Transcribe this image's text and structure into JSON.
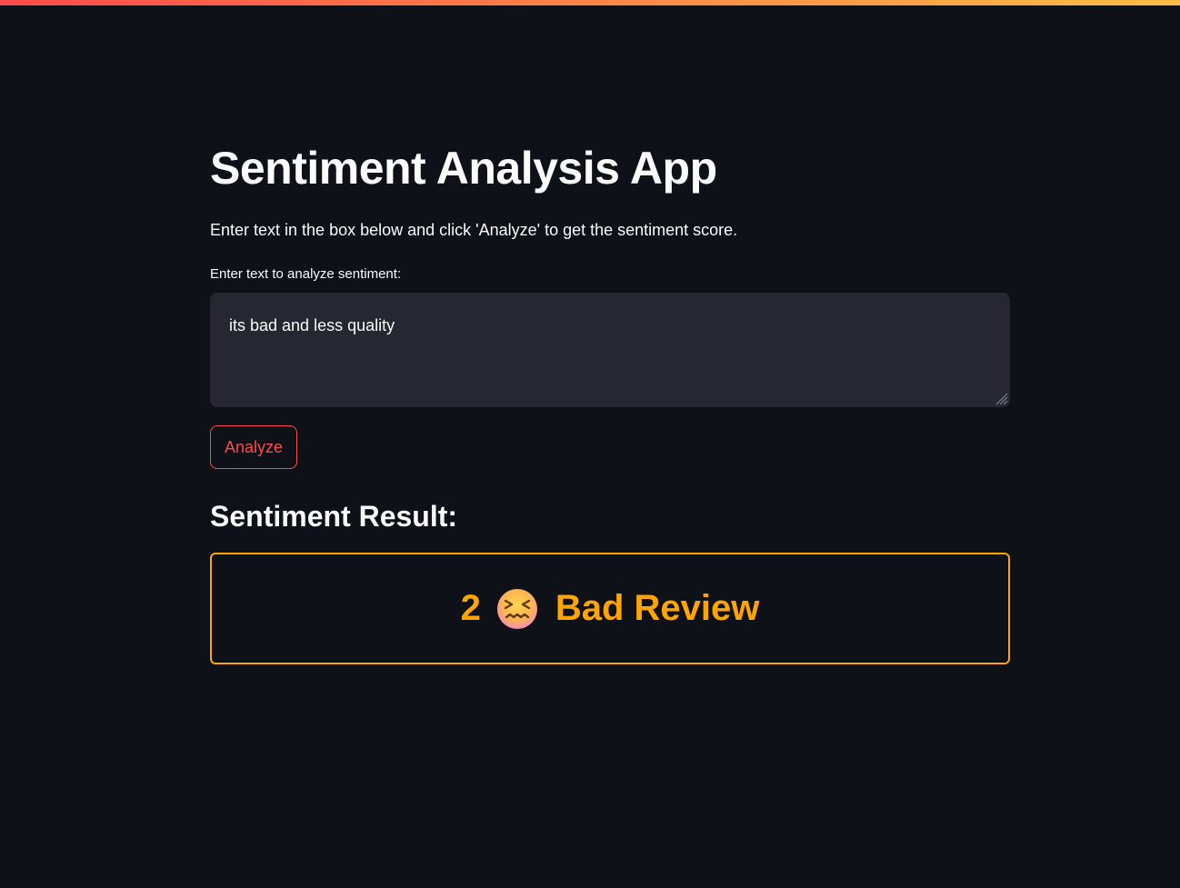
{
  "app": {
    "title": "Sentiment Analysis App",
    "description": "Enter text in the box below and click 'Analyze' to get the sentiment score."
  },
  "input": {
    "label": "Enter text to analyze sentiment:",
    "value": "its bad and less quality"
  },
  "actions": {
    "analyze_label": "Analyze"
  },
  "result": {
    "heading": "Sentiment Result:",
    "score": "2",
    "emoji_name": "confounded-face-icon",
    "label": "Bad Review",
    "color": "#ffa500"
  },
  "theme": {
    "background": "#0e1117",
    "accent": "#ff4b4b",
    "input_background": "#262730",
    "text": "#fafafa"
  }
}
